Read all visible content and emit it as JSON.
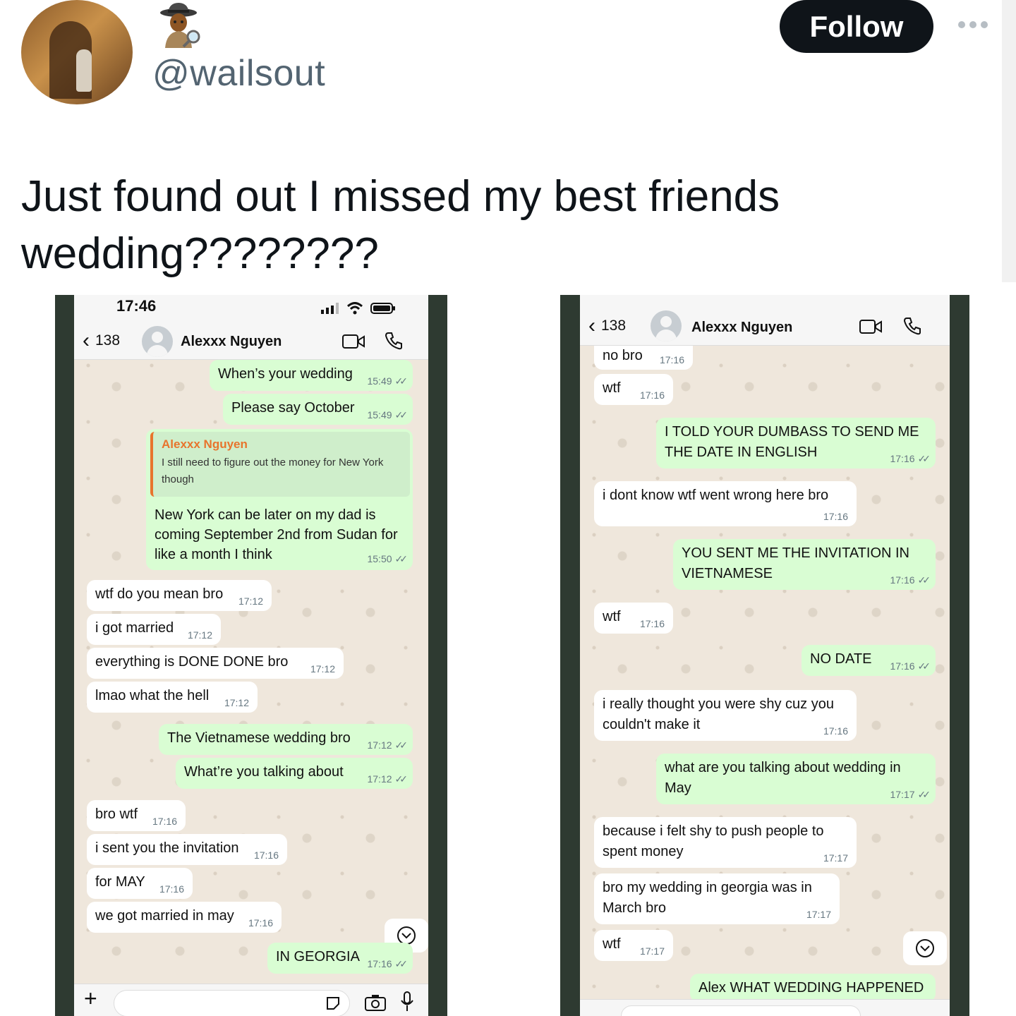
{
  "tweet": {
    "handle": "@wailsout",
    "follow_label": "Follow",
    "text": "Just found out I missed my best friends wedding????????",
    "emoji_name": "detective-emoji"
  },
  "left_phone": {
    "status_time": "17:46",
    "back_count": "138",
    "contact_name": "Alexxx Nguyen",
    "quote": {
      "name": "Alexxx Nguyen",
      "text": "I still need to figure out the money for New York though"
    },
    "messages": [
      {
        "dir": "out",
        "text": "When’s your wedding",
        "time": "15:49"
      },
      {
        "dir": "out",
        "text": "Please say October",
        "time": "15:49"
      },
      {
        "dir": "out",
        "text": "New York can be later on my dad is coming September 2nd from Sudan for like a month I think",
        "time": "15:50"
      },
      {
        "dir": "in",
        "text": "wtf do you mean bro",
        "time": "17:12"
      },
      {
        "dir": "in",
        "text": "i got married",
        "time": "17:12"
      },
      {
        "dir": "in",
        "text": "everything is DONE DONE bro",
        "time": "17:12"
      },
      {
        "dir": "in",
        "text": "lmao what the hell",
        "time": "17:12"
      },
      {
        "dir": "out",
        "text": "The Vietnamese wedding bro",
        "time": "17:12"
      },
      {
        "dir": "out",
        "text": "What’re you talking about",
        "time": "17:12"
      },
      {
        "dir": "in",
        "text": "bro wtf",
        "time": "17:16"
      },
      {
        "dir": "in",
        "text": "i sent you the invitation",
        "time": "17:16"
      },
      {
        "dir": "in",
        "text": "for MAY",
        "time": "17:16"
      },
      {
        "dir": "in",
        "text": "we got married in may",
        "time": "17:16"
      },
      {
        "dir": "out",
        "text": "IN GEORGIA",
        "time": "17:16"
      }
    ]
  },
  "right_phone": {
    "back_count": "138",
    "contact_name": "Alexxx Nguyen",
    "messages": [
      {
        "dir": "in",
        "text": "no bro",
        "time": "17:16"
      },
      {
        "dir": "in",
        "text": "wtf",
        "time": "17:16"
      },
      {
        "dir": "out",
        "text": "I TOLD YOUR DUMBASS TO SEND ME THE DATE IN ENGLISH",
        "time": "17:16"
      },
      {
        "dir": "in",
        "text": "i dont know wtf went wrong here bro",
        "time": "17:16"
      },
      {
        "dir": "out",
        "text": "YOU SENT ME THE INVITATION IN VIETNAMESE",
        "time": "17:16"
      },
      {
        "dir": "in",
        "text": "wtf",
        "time": "17:16"
      },
      {
        "dir": "out",
        "text": "NO DATE",
        "time": "17:16"
      },
      {
        "dir": "in",
        "text": "i really thought you were shy cuz you couldn't make it",
        "time": "17:16"
      },
      {
        "dir": "out",
        "text": "what are you talking about wedding in May",
        "time": "17:17"
      },
      {
        "dir": "in",
        "text": "because i felt shy to push people to spent money",
        "time": "17:17"
      },
      {
        "dir": "in",
        "text": "bro my wedding in georgia was in March bro",
        "time": "17:17"
      },
      {
        "dir": "in",
        "text": "wtf",
        "time": "17:17"
      },
      {
        "dir": "out",
        "text": "Alex WHAT WEDDING HAPPENED",
        "time": ""
      }
    ]
  }
}
